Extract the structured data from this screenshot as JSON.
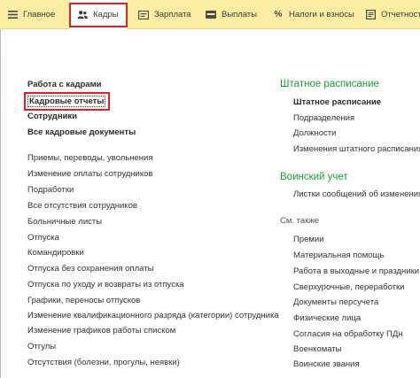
{
  "nav": {
    "tabs": [
      {
        "label": "Главное",
        "icon": "hamburger-icon"
      },
      {
        "label": "Кадры",
        "icon": "people-icon"
      },
      {
        "label": "Зарплата",
        "icon": "payroll-icon"
      },
      {
        "label": "Выплаты",
        "icon": "wallet-icon"
      },
      {
        "label": "Налоги и взносы",
        "icon": "percent-icon"
      },
      {
        "label": "Отчетност",
        "icon": "report-icon"
      }
    ]
  },
  "left": {
    "header_links": [
      "Работа с кадрами",
      "Кадровые отчеты",
      "Сотрудники",
      "Все кадровые документы"
    ],
    "documents": [
      "Приемы, переводы, увольнения",
      "Изменение оплаты сотрудников",
      "Подработки",
      "Все отсутствия сотрудников",
      "Больничные листы",
      "Отпуска",
      "Командировки",
      "Отпуска без сохранения оплаты",
      "Отпуска по уходу и возвраты из отпуска",
      "Графики, переносы отпусков",
      "Изменение квалификационного разряда (категории) сотрудника",
      "Изменение графиков работы списком",
      "Отгулы",
      "Отсутствия (болезни, прогулы, неявки)"
    ]
  },
  "right": {
    "staff_schedule": {
      "title": "Штатное расписание",
      "items": [
        "Штатное расписание",
        "Подразделения",
        "Должности",
        "Изменения штатного расписания"
      ]
    },
    "military": {
      "title": "Воинский учет",
      "items": [
        "Листки сообщений об изменениях"
      ]
    },
    "see_also": {
      "title": "См. также",
      "items": [
        "Премии",
        "Материальная помощь",
        "Работа в выходные и праздники",
        "Сверхурочные, переработки",
        "Документы персучета",
        "Физические лица",
        "Согласия на обработку ПДн",
        "Военкоматы",
        "Воинские звания"
      ]
    }
  }
}
